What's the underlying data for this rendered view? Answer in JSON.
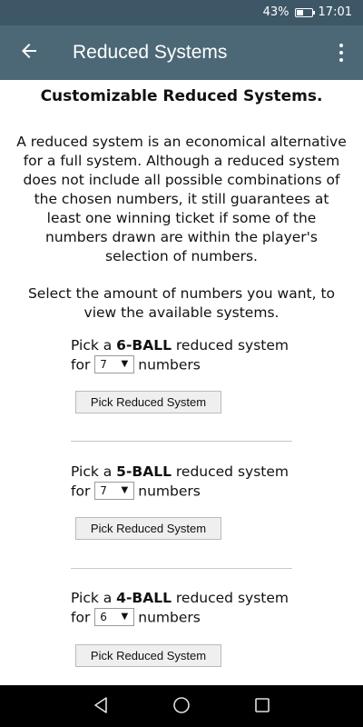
{
  "status_bar": {
    "battery_text": "43%",
    "battery_level": 0.43,
    "time": "17:01"
  },
  "app_bar": {
    "title": "Reduced Systems"
  },
  "content": {
    "heading": "Customizable Reduced Systems.",
    "description": "A reduced system is an economical alternative for a full system. Although a reduced system does not include all possible combinations of the chosen numbers, it still guarantees at least one winning ticket if some of the numbers drawn are within the player's selection of numbers.",
    "select_prompt": "Select the amount of numbers you want, to view the available systems.",
    "pickers": [
      {
        "prefix": "Pick a ",
        "ball": "6-BALL",
        "suffix": " reduced system",
        "for_label": "for",
        "value": "7",
        "numbers_label": "numbers",
        "button_label": "Pick Reduced System"
      },
      {
        "prefix": "Pick a ",
        "ball": "5-BALL",
        "suffix": " reduced system",
        "for_label": "for",
        "value": "7",
        "numbers_label": "numbers",
        "button_label": "Pick Reduced System"
      },
      {
        "prefix": "Pick a ",
        "ball": "4-BALL",
        "suffix": " reduced system",
        "for_label": "for",
        "value": "6",
        "numbers_label": "numbers",
        "button_label": "Pick Reduced System"
      }
    ]
  }
}
